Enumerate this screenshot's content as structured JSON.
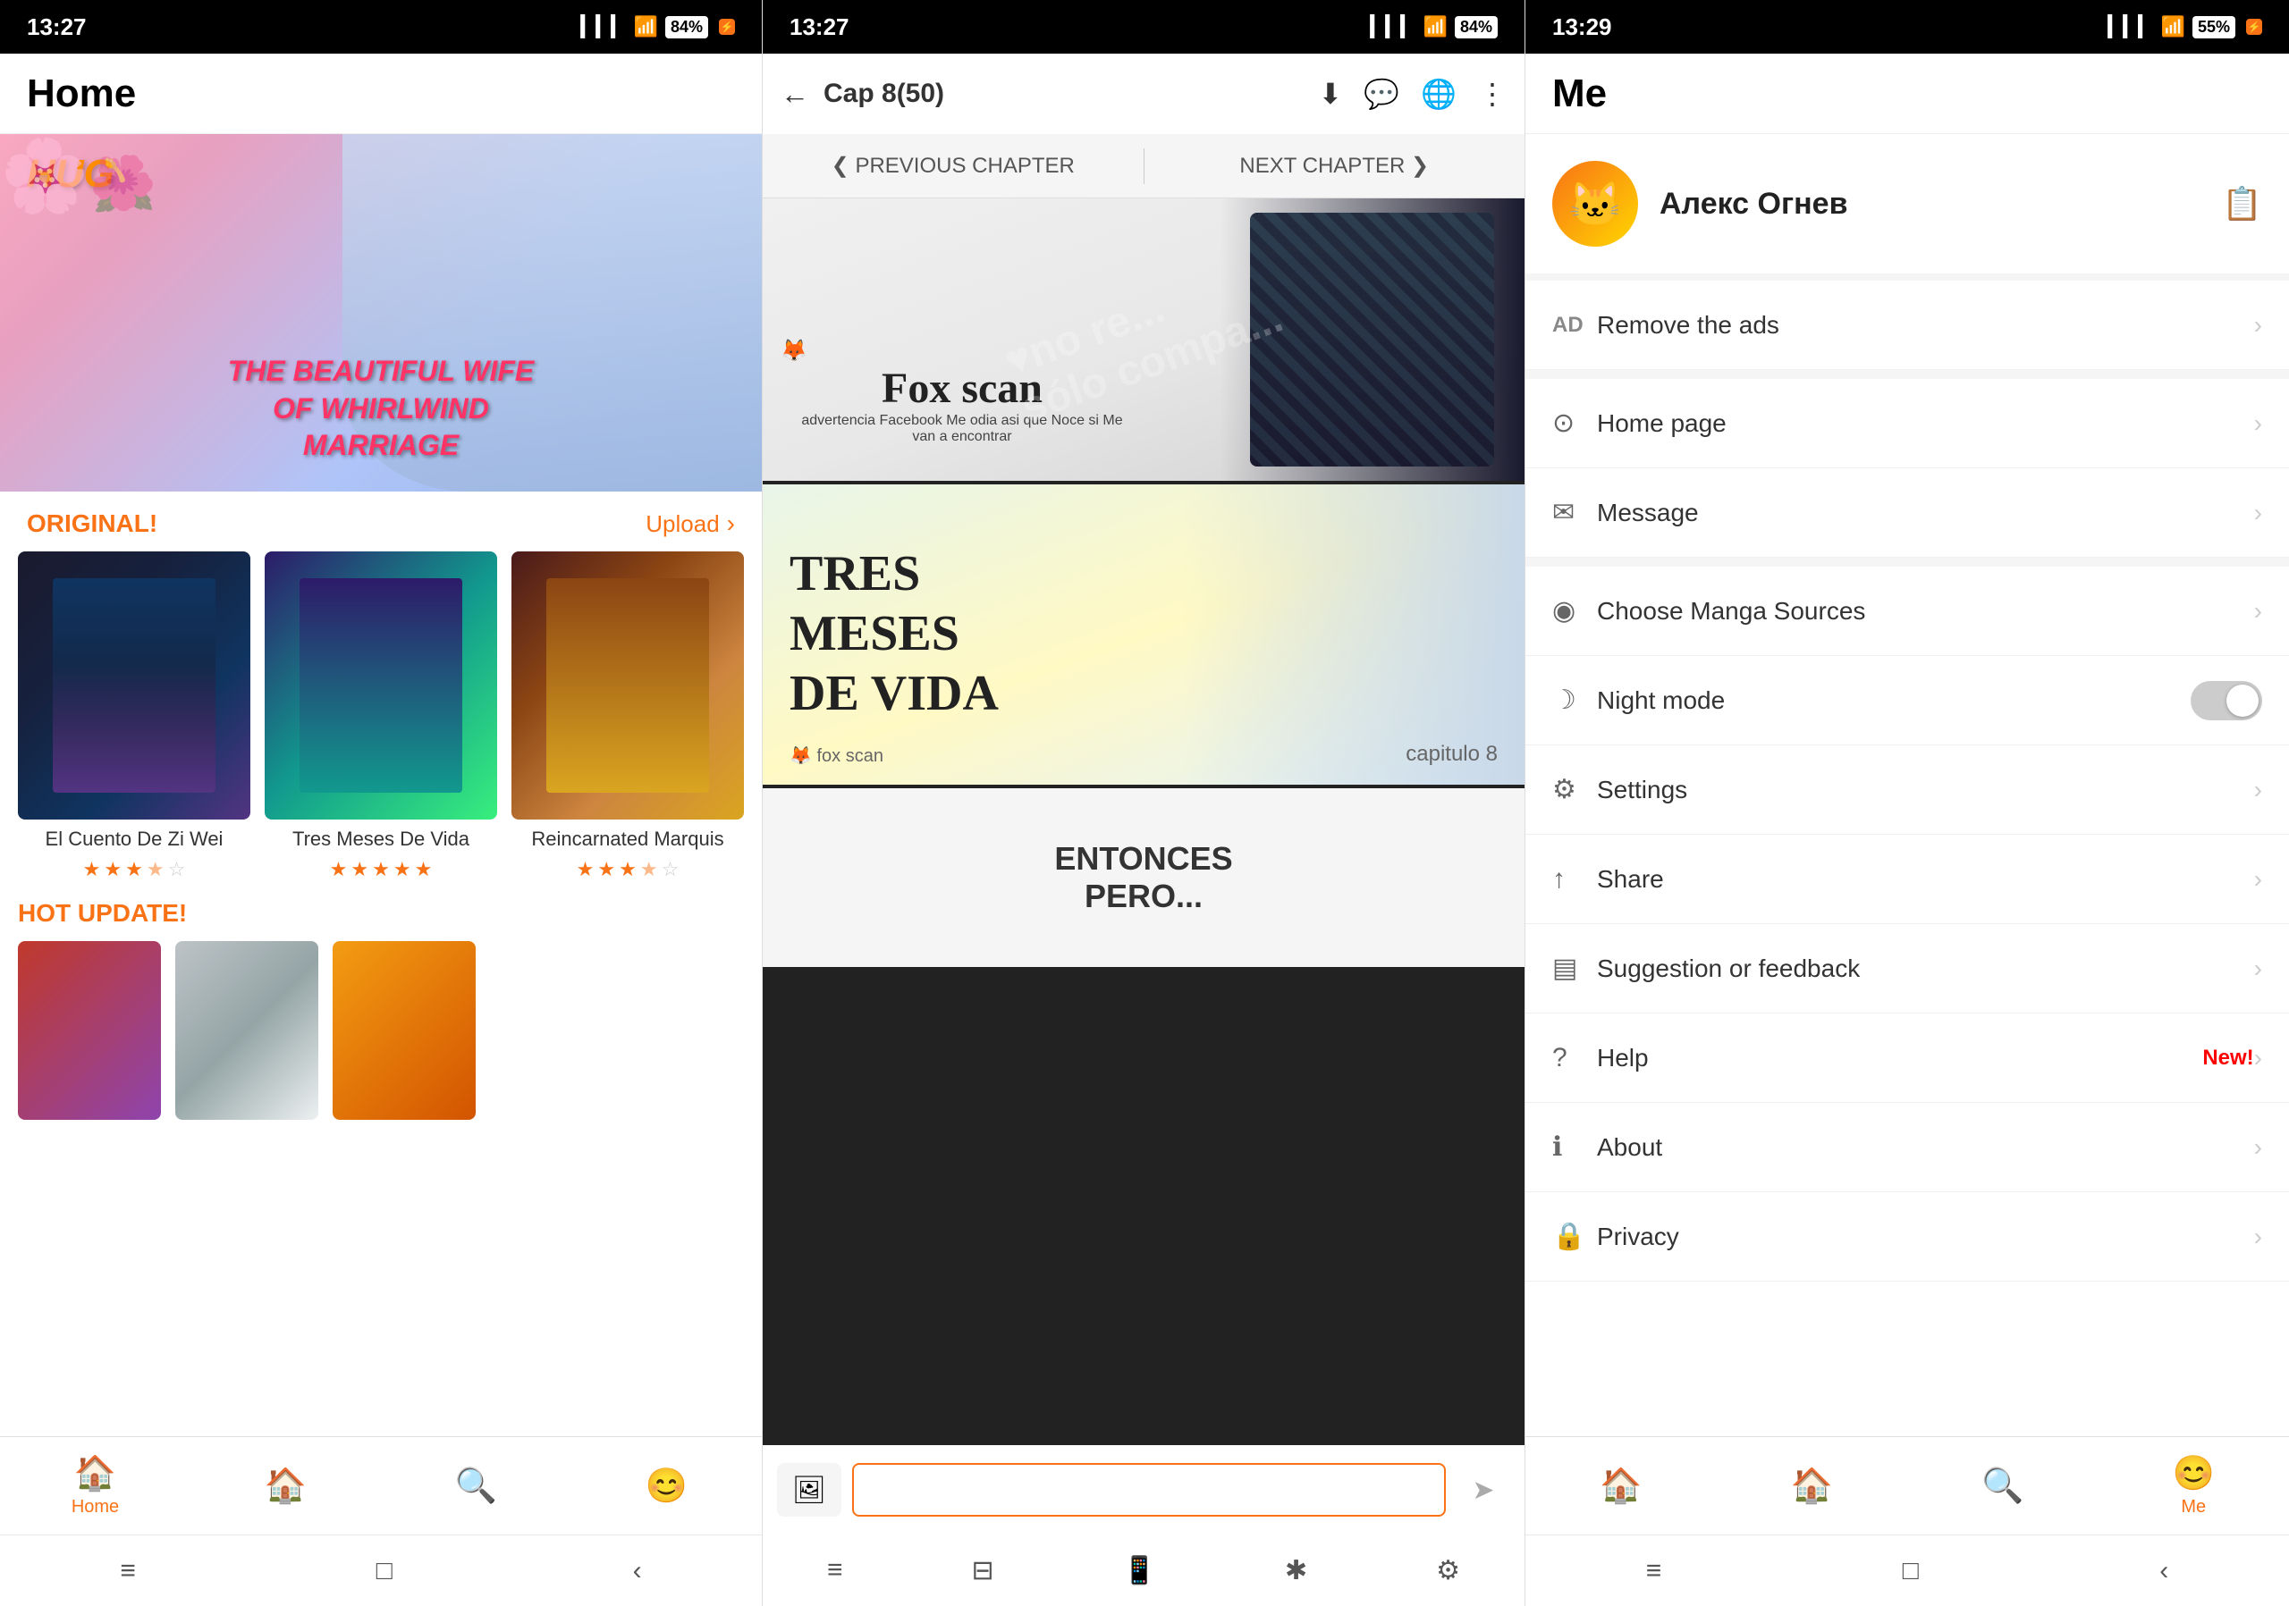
{
  "phone1": {
    "statusBar": {
      "time": "13:27",
      "battery": "84",
      "notch": "⚡"
    },
    "header": {
      "title": "Home"
    },
    "banner": {
      "hug": "HUG",
      "title": "THE BEAUTIFUL WIFE\nOF WHIRLWIND\nMARRIAGE"
    },
    "originalSection": {
      "title": "ORIGINAL!",
      "link": "Upload",
      "arrow": "›"
    },
    "mangaCards": [
      {
        "title": "El Cuento De Zi Wei",
        "stars": [
          1,
          1,
          1,
          0.5,
          0
        ],
        "coverClass": "cover-1"
      },
      {
        "title": "Tres Meses De Vida",
        "stars": [
          1,
          1,
          1,
          1,
          1
        ],
        "coverClass": "cover-2"
      },
      {
        "title": "Reincarnated\nMarquis",
        "stars": [
          1,
          1,
          1,
          0.5,
          0
        ],
        "coverClass": "cover-3"
      }
    ],
    "hotUpdate": {
      "title": "HOT UPDATE!"
    },
    "nav": {
      "items": [
        {
          "icon": "🏠",
          "label": "Home",
          "active": true
        },
        {
          "icon": "🏠",
          "label": "",
          "active": false
        },
        {
          "icon": "🔍",
          "label": "",
          "active": false
        },
        {
          "icon": "😊",
          "label": "",
          "active": false
        }
      ]
    },
    "sysNav": [
      "≡",
      "□",
      "‹"
    ]
  },
  "phone2": {
    "statusBar": {
      "time": "13:27",
      "battery": "84"
    },
    "header": {
      "back": "←",
      "chapter": "Cap 8(50)"
    },
    "chapterNav": {
      "prev": "❮ PREVIOUS CHAPTER",
      "next": "NEXT CHAPTER ❯"
    },
    "pages": [
      {
        "type": "foxscan",
        "watermarkText": "no re...\nsólo compa...",
        "foxText": "Fox scan",
        "caption": "advertencia Facebook Me odia asi que Noce si Me van a encontrar"
      },
      {
        "type": "tresMeses",
        "mainText": "TRES\nMESES\nDE VIDA",
        "foxLogo": "fox scan",
        "chapter": "capitulo 8"
      },
      {
        "type": "partial",
        "text": "ENTONCES\nPERO..."
      }
    ],
    "bottomBar": {
      "galleryIcon": "🖼",
      "sendIcon": "➤"
    },
    "sysNav": [
      "≡",
      "⊟",
      "📱",
      "✱",
      "⚙"
    ]
  },
  "phone3": {
    "statusBar": {
      "time": "13:29",
      "battery": "55"
    },
    "header": {
      "title": "Me"
    },
    "profile": {
      "avatar": "🐱",
      "username": "Алекс Огнев",
      "editIcon": "📋"
    },
    "menuItems": [
      {
        "icon": "AD",
        "label": "Remove the ads",
        "type": "ad"
      },
      {
        "icon": "⊙",
        "label": "Home page"
      },
      {
        "icon": "✉",
        "label": "Message"
      },
      {
        "icon": "◉",
        "label": "Choose Manga Sources"
      },
      {
        "icon": "☽",
        "label": "Night mode",
        "type": "toggle"
      },
      {
        "icon": "⚙",
        "label": "Settings"
      },
      {
        "icon": "↑",
        "label": "Share"
      },
      {
        "icon": "▤",
        "label": "Suggestion or feedback"
      },
      {
        "icon": "?",
        "label": "Help",
        "badge": "New!"
      },
      {
        "icon": "ℹ",
        "label": "About"
      },
      {
        "icon": "🔒",
        "label": "Privacy"
      }
    ],
    "nav": {
      "items": [
        {
          "icon": "🏠",
          "label": "",
          "active": false
        },
        {
          "icon": "🏠",
          "label": "",
          "active": false
        },
        {
          "icon": "🔍",
          "label": "",
          "active": false
        },
        {
          "icon": "😊",
          "label": "Me",
          "active": true
        }
      ]
    },
    "sysNav": [
      "≡",
      "□",
      "‹"
    ]
  }
}
